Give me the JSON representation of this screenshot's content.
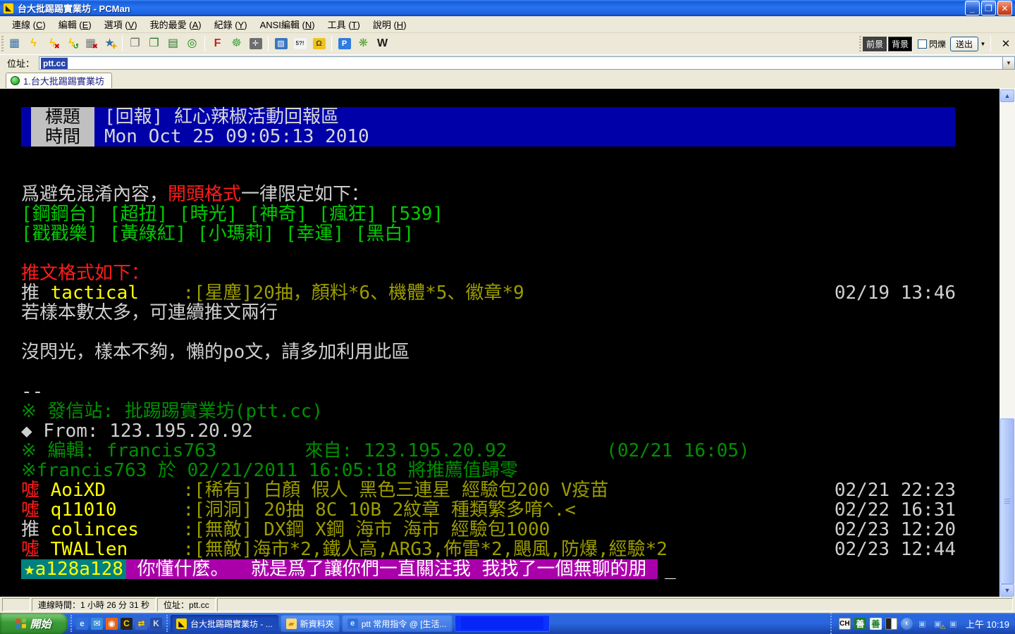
{
  "window": {
    "title": "台大批踢踢實業坊 - PCMan",
    "controls": {
      "minimize": "_",
      "restore": "❐",
      "close": "✕"
    }
  },
  "menu": {
    "items": [
      {
        "label": "連線",
        "key": "C"
      },
      {
        "label": "編輯",
        "key": "E"
      },
      {
        "label": "選項",
        "key": "V"
      },
      {
        "label": "我的最愛",
        "key": "A"
      },
      {
        "label": "紀錄",
        "key": "Y"
      },
      {
        "label": "ANSI編輯",
        "key": "N"
      },
      {
        "label": "工具",
        "key": "T"
      },
      {
        "label": "說明",
        "key": "H"
      }
    ]
  },
  "toolbar": {
    "groups": [
      [
        {
          "name": "site-manager-icon",
          "glyph": "▦",
          "color": "#3a6ea5"
        },
        {
          "name": "connect-icon",
          "glyph": "ϟ",
          "color": "#f5c400"
        },
        {
          "name": "disconnect-icon",
          "glyph": "ϟ",
          "color": "#f5c400",
          "overlay": "✖",
          "overlay_color": "#d40000"
        },
        {
          "name": "reconnect-icon",
          "glyph": "ϟ",
          "color": "#f5c400",
          "overlay": "↺",
          "overlay_color": "#0a8a0a"
        },
        {
          "name": "close-session-icon",
          "glyph": "▦",
          "color": "#7a7a7a",
          "overlay": "✖",
          "overlay_color": "#d40000"
        },
        {
          "name": "add-bookmark-icon",
          "glyph": "★",
          "color": "#3a6ea5",
          "overlay": "✚",
          "overlay_color": "#e8a800"
        }
      ],
      [
        {
          "name": "copy-icon",
          "glyph": "❐",
          "color": "#6a6a6a"
        },
        {
          "name": "paste-icon",
          "glyph": "❐",
          "color": "#2a7a2a"
        },
        {
          "name": "paste-ansi-icon",
          "glyph": "▤",
          "color": "#2a7a2a"
        },
        {
          "name": "find-icon",
          "glyph": "◎",
          "color": "#0a8a0a"
        }
      ],
      [
        {
          "name": "font-icon",
          "glyph": "F",
          "color": "#c42222"
        },
        {
          "name": "settings-gear-icon",
          "glyph": "☸",
          "color": "#4aa54a"
        },
        {
          "name": "screen-size-icon",
          "glyph": "✛",
          "color": "#ffffff",
          "bg": "#6e6e6e"
        }
      ],
      [
        {
          "name": "new-window-icon",
          "glyph": "▨",
          "color": "#ffffff",
          "bg": "#3a76c0"
        },
        {
          "name": "ansi-chars-icon",
          "glyph": "5?!",
          "color": "#333333",
          "bg": "#f4f4f4"
        },
        {
          "name": "unlock-icon",
          "glyph": "Ω",
          "color": "#5a4a00",
          "bg": "#f0c420"
        }
      ],
      [
        {
          "name": "pcman-search-icon",
          "glyph": "P",
          "color": "#ffffff",
          "bg": "#2f7ce0"
        },
        {
          "name": "flower-search-icon",
          "glyph": "❋",
          "color": "#57a639"
        },
        {
          "name": "wikipedia-icon",
          "glyph": "W",
          "color": "#1a1a1a"
        }
      ]
    ],
    "foreground_label": "前景",
    "background_label": "背景",
    "blink_label": "閃爍",
    "send_label": "送出",
    "close_toolbar_glyph": "✕"
  },
  "addressbar": {
    "label": "位址：",
    "value": "ptt.cc"
  },
  "tabbar": {
    "active_tab": "1.台大批踢踢實業坊"
  },
  "terminal": {
    "colors": {
      "white": "#cfcfcf",
      "bright_white": "#ffffff",
      "red": "#ff1c1c",
      "green": "#00cc00",
      "dark_green": "#009000",
      "yellow": "#ffff00",
      "olive": "#9c9c00",
      "header_bg": "#0000a8",
      "header_label_bg": "#c0c0c0",
      "magenta_bg": "#aa00aa",
      "teal_bg": "#008080"
    },
    "header": {
      "label_line1": "標題",
      "label_line2": "時間",
      "title": "[回報] 紅心辣椒活動回報區",
      "time": "Mon Oct 25 09:05:13 2010"
    },
    "lines": [
      {
        "segments": [
          {
            "t": "爲避免混淆內容，",
            "c": "white"
          },
          {
            "t": "開頭格式",
            "c": "red"
          },
          {
            "t": "一律限定如下：",
            "c": "white"
          }
        ]
      },
      {
        "segments": [
          {
            "t": "[鋼鋼台] [超扭] [時光] [神奇] [瘋狂] [539]",
            "c": "green"
          }
        ]
      },
      {
        "segments": [
          {
            "t": "[戳戳樂] [黃綠紅] [小瑪莉] [幸運] [黑白]",
            "c": "green"
          }
        ]
      },
      {
        "segments": []
      },
      {
        "segments": [
          {
            "t": "推文格式如下：",
            "c": "red"
          }
        ]
      },
      {
        "segments": [
          {
            "t": "推 ",
            "c": "white"
          },
          {
            "t": "tactical",
            "c": "yellow"
          },
          {
            "t": "    :[星塵]20抽，顏料*6、機體*5、徽章*9",
            "c": "olive"
          }
        ],
        "timestamp": "02/19 13:46"
      },
      {
        "segments": [
          {
            "t": "若樣本數太多，可連續推文兩行",
            "c": "white"
          }
        ]
      },
      {
        "segments": []
      },
      {
        "segments": [
          {
            "t": "沒閃光，樣本不夠，懶的po文，請多加利用此區",
            "c": "white"
          }
        ]
      },
      {
        "segments": []
      },
      {
        "segments": [
          {
            "t": "--",
            "c": "white"
          }
        ]
      },
      {
        "segments": [
          {
            "t": "※ 發信站: 批踢踢實業坊(ptt.cc)",
            "c": "dark_green"
          }
        ]
      },
      {
        "segments": [
          {
            "t": "◆ From: 123.195.20.92",
            "c": "white"
          }
        ]
      },
      {
        "segments": [
          {
            "t": "※ 編輯: francis763        來自: 123.195.20.92         (02/21 16:05)",
            "c": "dark_green"
          }
        ]
      },
      {
        "segments": [
          {
            "t": "※francis763 於 02/21/2011 16:05:18 將推薦值歸零",
            "c": "dark_green"
          }
        ]
      },
      {
        "segments": [
          {
            "t": "噓 ",
            "c": "red"
          },
          {
            "t": "AoiXD",
            "c": "yellow"
          },
          {
            "t": "       :[稀有] 白顏 假人 黑色三連星 經驗包200 V疫苗",
            "c": "olive"
          }
        ],
        "timestamp": "02/21 22:23"
      },
      {
        "segments": [
          {
            "t": "噓 ",
            "c": "red"
          },
          {
            "t": "q11010",
            "c": "yellow"
          },
          {
            "t": "      :[洞洞] 20抽 8C 10B 2紋章 種類繁多唷^.<",
            "c": "olive"
          }
        ],
        "timestamp": "02/22 16:31"
      },
      {
        "segments": [
          {
            "t": "推 ",
            "c": "white"
          },
          {
            "t": "colinces",
            "c": "yellow"
          },
          {
            "t": "    :[無敵] DX鋼 X鋼 海市 海市 經驗包1000",
            "c": "olive"
          }
        ],
        "timestamp": "02/23 12:20"
      },
      {
        "segments": [
          {
            "t": "噓 ",
            "c": "red"
          },
          {
            "t": "TWALlen",
            "c": "yellow"
          },
          {
            "t": "     :[無敵]海市*2,鐵人高,ARG3,佈雷*2,颶風,防爆,經驗*2",
            "c": "olive"
          }
        ],
        "timestamp": "02/23 12:44"
      }
    ],
    "bottom_line": {
      "star_id": "★a128a128",
      "message": " 你懂什麼。  就是爲了讓你們一直關注我 我找了一個無聊的朋 ",
      "cursor": "_"
    }
  },
  "statusbar": {
    "connection": "連線時間：1 小時 26 分 31 秒",
    "address": "位址：ptt.cc"
  },
  "taskbar": {
    "start_label": "開始",
    "quick_launch": [
      {
        "name": "ie-quicklaunch-icon",
        "glyph": "e",
        "color": "#d8e8ff",
        "bg": "#2f6fd8"
      },
      {
        "name": "mail-quicklaunch-icon",
        "glyph": "✉",
        "color": "#ffffff",
        "bg": "#3a8ad8"
      },
      {
        "name": "media-player-quicklaunch-icon",
        "glyph": "◉",
        "color": "#ffffff",
        "bg": "#e8641a"
      },
      {
        "name": "pcman-quicklaunch-icon",
        "glyph": "C",
        "color": "#ffd400",
        "bg": "#222222"
      },
      {
        "name": "transfer-quicklaunch-icon",
        "glyph": "⇄",
        "color": "#ffd400",
        "bg": "#3a62c8"
      },
      {
        "name": "app-k-quicklaunch-icon",
        "glyph": "K",
        "color": "#bfe0ff",
        "bg": "#2a4aa0"
      }
    ],
    "buttons": [
      {
        "name": "taskbar-button-pcman",
        "icon_glyph": "◣",
        "icon_color": "#111111",
        "icon_bg": "#ffd400",
        "label": "台大批踢踢實業坊 - ...",
        "state": "active"
      },
      {
        "name": "taskbar-button-folder",
        "icon_glyph": "▰",
        "icon_color": "#c89200",
        "icon_bg": "#ffd876",
        "label": "新資料夾",
        "state": "normal"
      },
      {
        "name": "taskbar-button-ie",
        "icon_glyph": "e",
        "icon_color": "#d8e8ff",
        "icon_bg": "#2f6fd8",
        "label": "ptt 常用指令 @ [生活...",
        "state": "normal"
      },
      {
        "name": "taskbar-button-flashing",
        "icon_glyph": "",
        "icon_color": "",
        "icon_bg": "",
        "label": "",
        "state": "flash"
      }
    ],
    "tray": {
      "language": "CH",
      "ime_icons": [
        {
          "name": "ime-chinese-icon",
          "glyph": "善",
          "color": "#ffffff",
          "bg": "#1e7a2e"
        },
        {
          "name": "ime-keyboard-icon",
          "glyph": "善",
          "color": "#1e7a2e",
          "bg": "#e8f4e8"
        }
      ],
      "time": "上午 10:19"
    }
  }
}
